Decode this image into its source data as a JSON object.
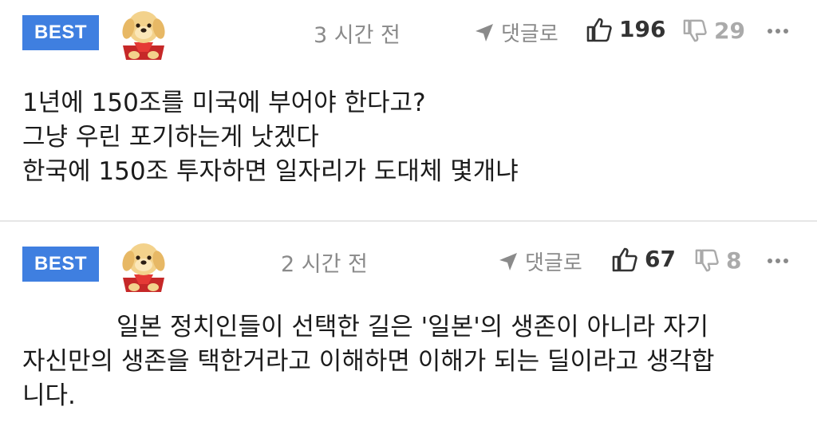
{
  "comments": [
    {
      "badge": "BEST",
      "time": "3 시간 전",
      "reply_label": "댓글로",
      "likes": "196",
      "dislikes": "29",
      "lines": [
        "1년에 150조를 미국에 부어야 한다고?",
        "그냥 우린 포기하는게 낫겠다",
        "한국에 150조 투자하면 일자리가 도대체 몇개냐"
      ]
    },
    {
      "badge": "BEST",
      "time": "2 시간 전",
      "reply_label": "댓글로",
      "likes": "67",
      "dislikes": "8",
      "lines": [
        "일본 정치인들이 선택한 길은 '일본'의 생존이 아니라 자기",
        "자신만의 생존을 택한거라고 이해하면 이해가 되는 딜이라고 생각합",
        "니다."
      ]
    }
  ],
  "icons": {
    "avatar": "puppy-avatar-icon",
    "reply": "reply-arrow-icon",
    "like": "thumbs-up-icon",
    "dislike": "thumbs-down-icon",
    "more": "more-dots-icon"
  },
  "colors": {
    "badge": "#3f7fe0",
    "muted": "#8a8a8a",
    "divider": "#e6e6e6"
  }
}
